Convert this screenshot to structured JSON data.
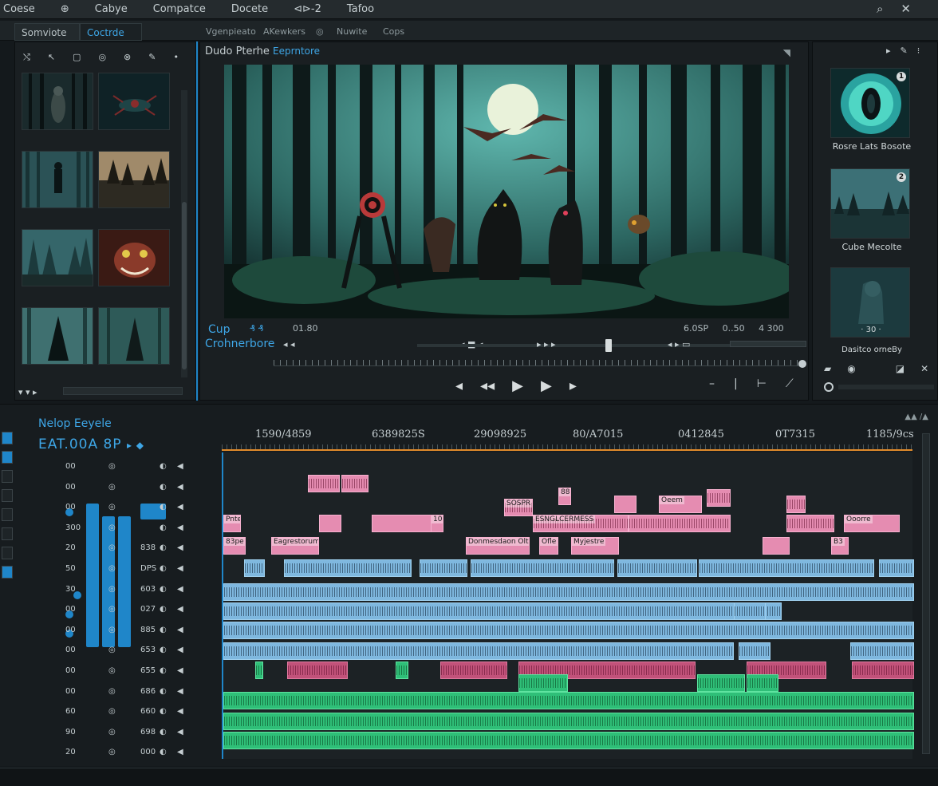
{
  "menu": [
    "Coese",
    "⊕",
    "Cabye",
    "Compatce",
    "Docete",
    "⊲⊳-2",
    "Tafoo"
  ],
  "menu_right": {
    "search_icon": "search-icon",
    "close_icon": "close-icon"
  },
  "tabs": {
    "tab1": "Somviote",
    "tab2": "Coctrde"
  },
  "subbar_items": [
    "Vgenpieato",
    "AKewkers",
    "◎",
    "Nuwite",
    "Cops"
  ],
  "viewer": {
    "title": "Dudo Pterhe",
    "title_accent": "Eeprntore",
    "clip_label": "Cup",
    "clip_icons": "₰ ₰",
    "tc_start": "01.80",
    "chron_label": "Crohnerbore",
    "tc_right1": "6.0SP",
    "tc_right2": "0..50",
    "tc_right3": "4 300",
    "transport_left": "◂ ◂",
    "transport_mid": "◂ ■ ◂",
    "transport_mid2": "▸ ▸ ▸",
    "transport_right": "◂ ▸ ▭"
  },
  "right_panel": {
    "items": [
      {
        "label": "Rosre Lats Bosote",
        "badge": "1"
      },
      {
        "label": "Cube Mecolte",
        "badge": "2"
      },
      {
        "label": "Dasitco orneBy",
        "badge": ""
      }
    ],
    "overlay_text": "· 30 ·"
  },
  "timeline": {
    "title": "Nelop Eeyele",
    "timecode": "EAT.00A 8P",
    "ruler_labels": [
      "1590/4859",
      "6389825S",
      "29098925",
      "80/A7015",
      "0412845",
      "0T7315",
      "1185/9cs"
    ],
    "track_numbers": [
      "00",
      "00",
      "00",
      "300",
      "20",
      "50",
      "30",
      "00",
      "00",
      "00",
      "00",
      "00",
      "60",
      "90",
      "20"
    ],
    "track_codes": [
      "",
      "",
      "",
      "",
      "838",
      "DPS",
      "603",
      "027",
      "885",
      "653",
      "655",
      "686",
      "660",
      "698",
      "000"
    ],
    "clip_texts": {
      "c1": "Pnte",
      "c2": "Eagrestorum",
      "c3": "Donmesdaon Olte",
      "c4": "Ofle",
      "c5": "Myjestre",
      "c6": "Ooorre",
      "c7": "83pe",
      "c8": "SOSPR REUT MIEEBER",
      "c9": "88",
      "c10": "ESNGLCERMESS",
      "c11": "Oeem",
      "c12": "10",
      "c13": "B3"
    }
  },
  "colors": {
    "accent": "#1f86c9",
    "accent_text": "#3ea6e6",
    "video_clip": "#e58cb1",
    "audio_clip": "#7fb8df",
    "red_clip": "#c2527a",
    "green_clip": "#2fbf78",
    "playhead_marker": "#e08a2b"
  }
}
